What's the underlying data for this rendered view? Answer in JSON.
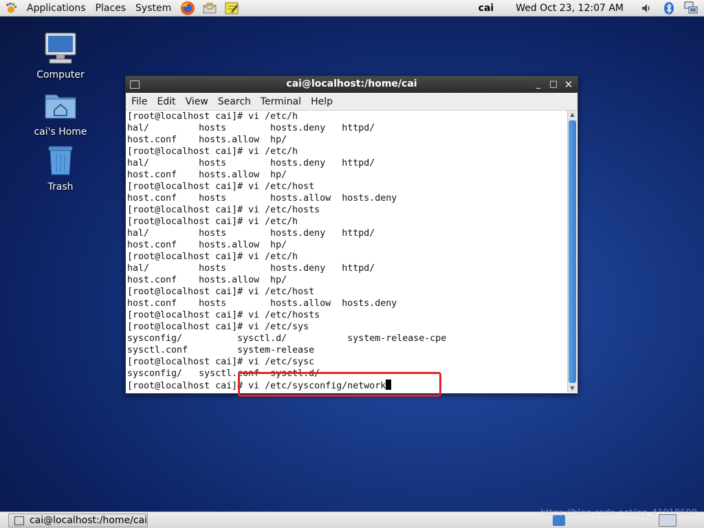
{
  "top_panel": {
    "menus": [
      "Applications",
      "Places",
      "System"
    ],
    "user": "cai",
    "clock": "Wed Oct 23, 12:07 AM"
  },
  "desktop": {
    "icons": [
      {
        "label": "Computer",
        "icon": "computer-icon"
      },
      {
        "label": "cai's Home",
        "icon": "home-folder-icon"
      },
      {
        "label": "Trash",
        "icon": "trash-icon"
      }
    ]
  },
  "terminal": {
    "title": "cai@localhost:/home/cai",
    "menus": [
      "File",
      "Edit",
      "View",
      "Search",
      "Terminal",
      "Help"
    ],
    "lines": [
      "[root@localhost cai]# vi /etc/h",
      "hal/         hosts        hosts.deny   httpd/",
      "host.conf    hosts.allow  hp/",
      "[root@localhost cai]# vi /etc/h",
      "hal/         hosts        hosts.deny   httpd/",
      "host.conf    hosts.allow  hp/",
      "[root@localhost cai]# vi /etc/host",
      "host.conf    hosts        hosts.allow  hosts.deny",
      "[root@localhost cai]# vi /etc/hosts",
      "[root@localhost cai]# vi /etc/h",
      "hal/         hosts        hosts.deny   httpd/",
      "host.conf    hosts.allow  hp/",
      "[root@localhost cai]# vi /etc/h",
      "hal/         hosts        hosts.deny   httpd/",
      "host.conf    hosts.allow  hp/",
      "[root@localhost cai]# vi /etc/host",
      "host.conf    hosts        hosts.allow  hosts.deny",
      "[root@localhost cai]# vi /etc/hosts",
      "[root@localhost cai]# vi /etc/sys",
      "sysconfig/          sysctl.d/           system-release-cpe",
      "sysctl.conf         system-release",
      "[root@localhost cai]# vi /etc/sysc",
      "sysconfig/   sysctl.conf  sysctl.d/"
    ],
    "current_line": "[root@localhost cai]# vi /etc/sysconfig/network"
  },
  "taskbar": {
    "window_button": "cai@localhost:/home/cai",
    "watermark": "https://blog.csdn.net/qq_41918600"
  },
  "colors": {
    "highlight_box": "#e3232b",
    "scroll_thumb": "#3d7fcf"
  }
}
